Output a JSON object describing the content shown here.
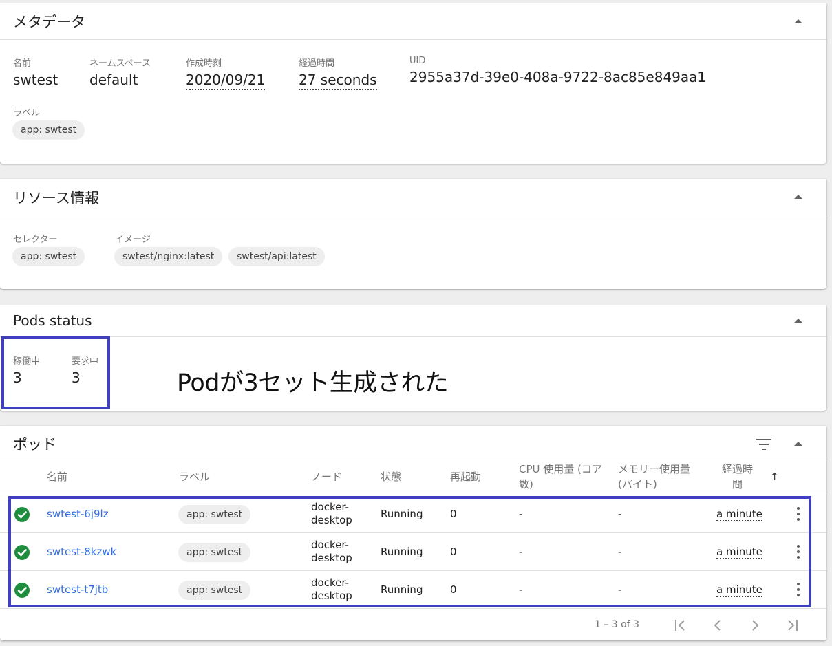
{
  "metadata": {
    "title": "メタデータ",
    "fields": [
      {
        "label": "名前",
        "value": "swtest"
      },
      {
        "label": "ネームスペース",
        "value": "default"
      },
      {
        "label": "作成時刻",
        "value": "2020/09/21"
      },
      {
        "label": "経過時間",
        "value": "27 seconds"
      },
      {
        "label": "UID",
        "value": "2955a37d-39e0-408a-9722-8ac85e849aa1"
      }
    ],
    "labels_title": "ラベル",
    "labels": [
      "app: swtest"
    ]
  },
  "resources": {
    "title": "リソース情報",
    "selector_label": "セレクター",
    "selectors": [
      "app: swtest"
    ],
    "image_label": "イメージ",
    "images": [
      "swtest/nginx:latest",
      "swtest/api:latest"
    ]
  },
  "pods_status": {
    "title": "Pods status",
    "running_label": "稼働中",
    "running_value": "3",
    "desired_label": "要求中",
    "desired_value": "3",
    "annotation": "Podが3セット生成された"
  },
  "pods": {
    "title": "ポッド",
    "columns": {
      "name": "名前",
      "labels": "ラベル",
      "node": "ノード",
      "status": "状態",
      "restarts": "再起動",
      "cpu_line1": "CPU 使用量 (コア",
      "cpu_line2": "数)",
      "memory_line1": "メモリー使用量",
      "memory_line2": "(バイト)",
      "age_line1": "経過時",
      "age_line2": "間",
      "sort_arrow": "↑"
    },
    "rows": [
      {
        "name": "swtest-6j9lz",
        "label": "app: swtest",
        "node_line1": "docker-",
        "node_line2": "desktop",
        "status": "Running",
        "restarts": "0",
        "cpu": "-",
        "memory": "-",
        "age": "a minute"
      },
      {
        "name": "swtest-8kzwk",
        "label": "app: swtest",
        "node_line1": "docker-",
        "node_line2": "desktop",
        "status": "Running",
        "restarts": "0",
        "cpu": "-",
        "memory": "-",
        "age": "a minute"
      },
      {
        "name": "swtest-t7jtb",
        "label": "app: swtest",
        "node_line1": "docker-",
        "node_line2": "desktop",
        "status": "Running",
        "restarts": "0",
        "cpu": "-",
        "memory": "-",
        "age": "a minute"
      }
    ],
    "pagination": {
      "range": "1 – 3 of 3"
    }
  },
  "colors": {
    "link": "#326de6",
    "ok_status": "#1e8e3e",
    "highlight": "#3f3fbf"
  },
  "icons": [
    "collapse-caret-icon",
    "filter-icon",
    "check-circle-icon",
    "more-vert-icon",
    "first-page-icon",
    "prev-page-icon",
    "next-page-icon",
    "last-page-icon"
  ]
}
